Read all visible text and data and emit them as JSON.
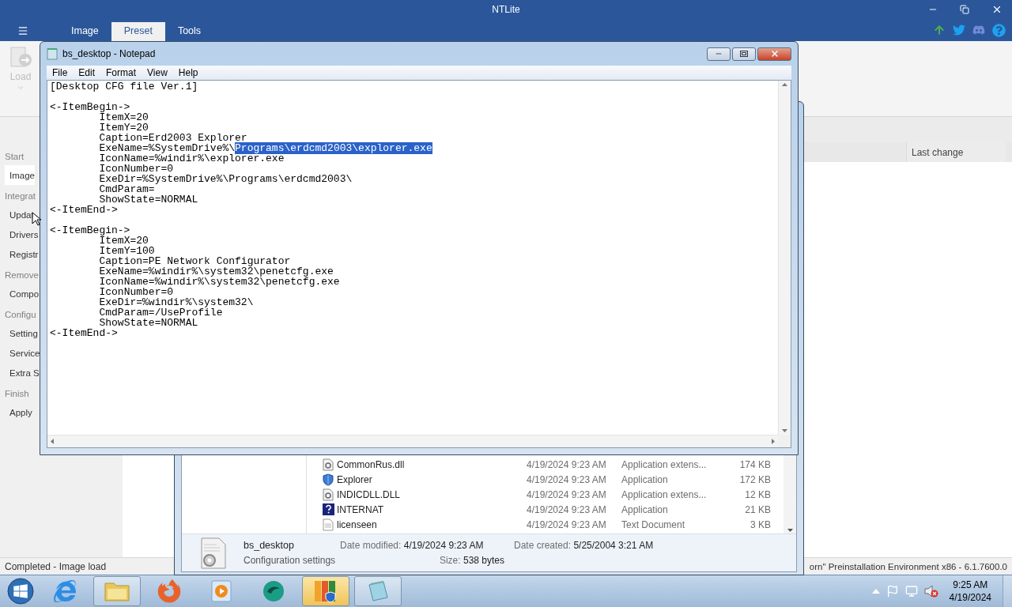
{
  "app": {
    "title": "NTLite",
    "tabs": [
      {
        "label": "Image",
        "selected": false
      },
      {
        "label": "Preset",
        "selected": true
      },
      {
        "label": "Tools",
        "selected": false
      }
    ],
    "ribbon": {
      "buttons": [
        {
          "label": "Load",
          "disabled": true
        }
      ]
    },
    "sidebar": {
      "sections": [
        {
          "title": "Start",
          "items": [
            {
              "label": "Image",
              "selected": true
            }
          ]
        },
        {
          "title": "Integrat",
          "items": [
            {
              "label": "Updat",
              "selected": false
            },
            {
              "label": "Drivers",
              "selected": false
            },
            {
              "label": "Registr",
              "selected": false
            }
          ]
        },
        {
          "title": "Remove",
          "items": [
            {
              "label": "Compo",
              "selected": false
            }
          ]
        },
        {
          "title": "Configu",
          "items": [
            {
              "label": "Setting",
              "selected": false
            },
            {
              "label": "Service",
              "selected": false
            },
            {
              "label": "Extra S",
              "selected": false
            }
          ]
        },
        {
          "title": "Finish",
          "items": [
            {
              "label": "Apply",
              "selected": false
            }
          ]
        }
      ]
    },
    "table": {
      "columns": [
        "Last change"
      ]
    },
    "status_bar": {
      "left": "Completed - Image load",
      "right": "orn\" Preinstallation Environment x86 - 6.1.7600.0"
    }
  },
  "notepad": {
    "title": "bs_desktop - Notepad",
    "menu": [
      "File",
      "Edit",
      "Format",
      "View",
      "Help"
    ],
    "content": {
      "before": "[Desktop CFG file Ver.1]\n\n<-ItemBegin->\n\tItemX=20\n\tItemY=20\n\tCaption=Erd2003 Explorer\n\tExeName=%SystemDrive%\\",
      "selected": "Programs\\erdcmd2003\\explorer.exe",
      "after": "\n\tIconName=%windir%\\explorer.exe\n\tIconNumber=0\n\tExeDir=%SystemDrive%\\Programs\\erdcmd2003\\\n\tCmdParam=\n\tShowState=NORMAL\n<-ItemEnd->\n\n<-ItemBegin->\n\tItemX=20\n\tItemY=100\n\tCaption=PE Network Configurator\n\tExeName=%windir%\\system32\\penetcfg.exe\n\tIconName=%windir%\\system32\\penetcfg.exe\n\tIconNumber=0\n\tExeDir=%windir%\\system32\\\n\tCmdParam=/UseProfile\n\tShowState=NORMAL\n<-ItemEnd->"
    }
  },
  "explorer": {
    "files": [
      {
        "kind": "extension",
        "name": "CommonRus.dll",
        "date": "4/19/2024 9:23 AM",
        "type": "Application extens...",
        "size": "174 KB"
      },
      {
        "kind": "application",
        "name": "Explorer",
        "date": "4/19/2024 9:23 AM",
        "type": "Application",
        "size": "172 KB"
      },
      {
        "kind": "extension",
        "name": "INDICDLL.DLL",
        "date": "4/19/2024 9:23 AM",
        "type": "Application extens...",
        "size": "12 KB"
      },
      {
        "kind": "help",
        "name": "INTERNAT",
        "date": "4/19/2024 9:23 AM",
        "type": "Application",
        "size": "21 KB"
      },
      {
        "kind": "text",
        "name": "licenseen",
        "date": "4/19/2024 9:23 AM",
        "type": "Text Document",
        "size": "3 KB"
      }
    ],
    "details": {
      "name": "bs_desktop",
      "type": "Configuration settings",
      "fields": [
        {
          "label": "Date modified:",
          "value": "4/19/2024 9:23 AM"
        },
        {
          "label": "Date created:",
          "value": "5/25/2004 3:21 AM"
        },
        {
          "label": "Size:",
          "value": "538 bytes"
        }
      ]
    }
  },
  "taskbar": {
    "apps": [
      {
        "kind": "ie",
        "running": false,
        "selected": false
      },
      {
        "kind": "folder",
        "running": true,
        "selected": false
      },
      {
        "kind": "firefox",
        "running": false,
        "selected": false
      },
      {
        "kind": "media",
        "running": false,
        "selected": false
      },
      {
        "kind": "teal",
        "running": false,
        "selected": false
      },
      {
        "kind": "ntlite",
        "running": true,
        "selected": true
      },
      {
        "kind": "notepad",
        "running": true,
        "selected": false
      }
    ],
    "clock": {
      "time": "9:25 AM",
      "date": "4/19/2024"
    }
  }
}
